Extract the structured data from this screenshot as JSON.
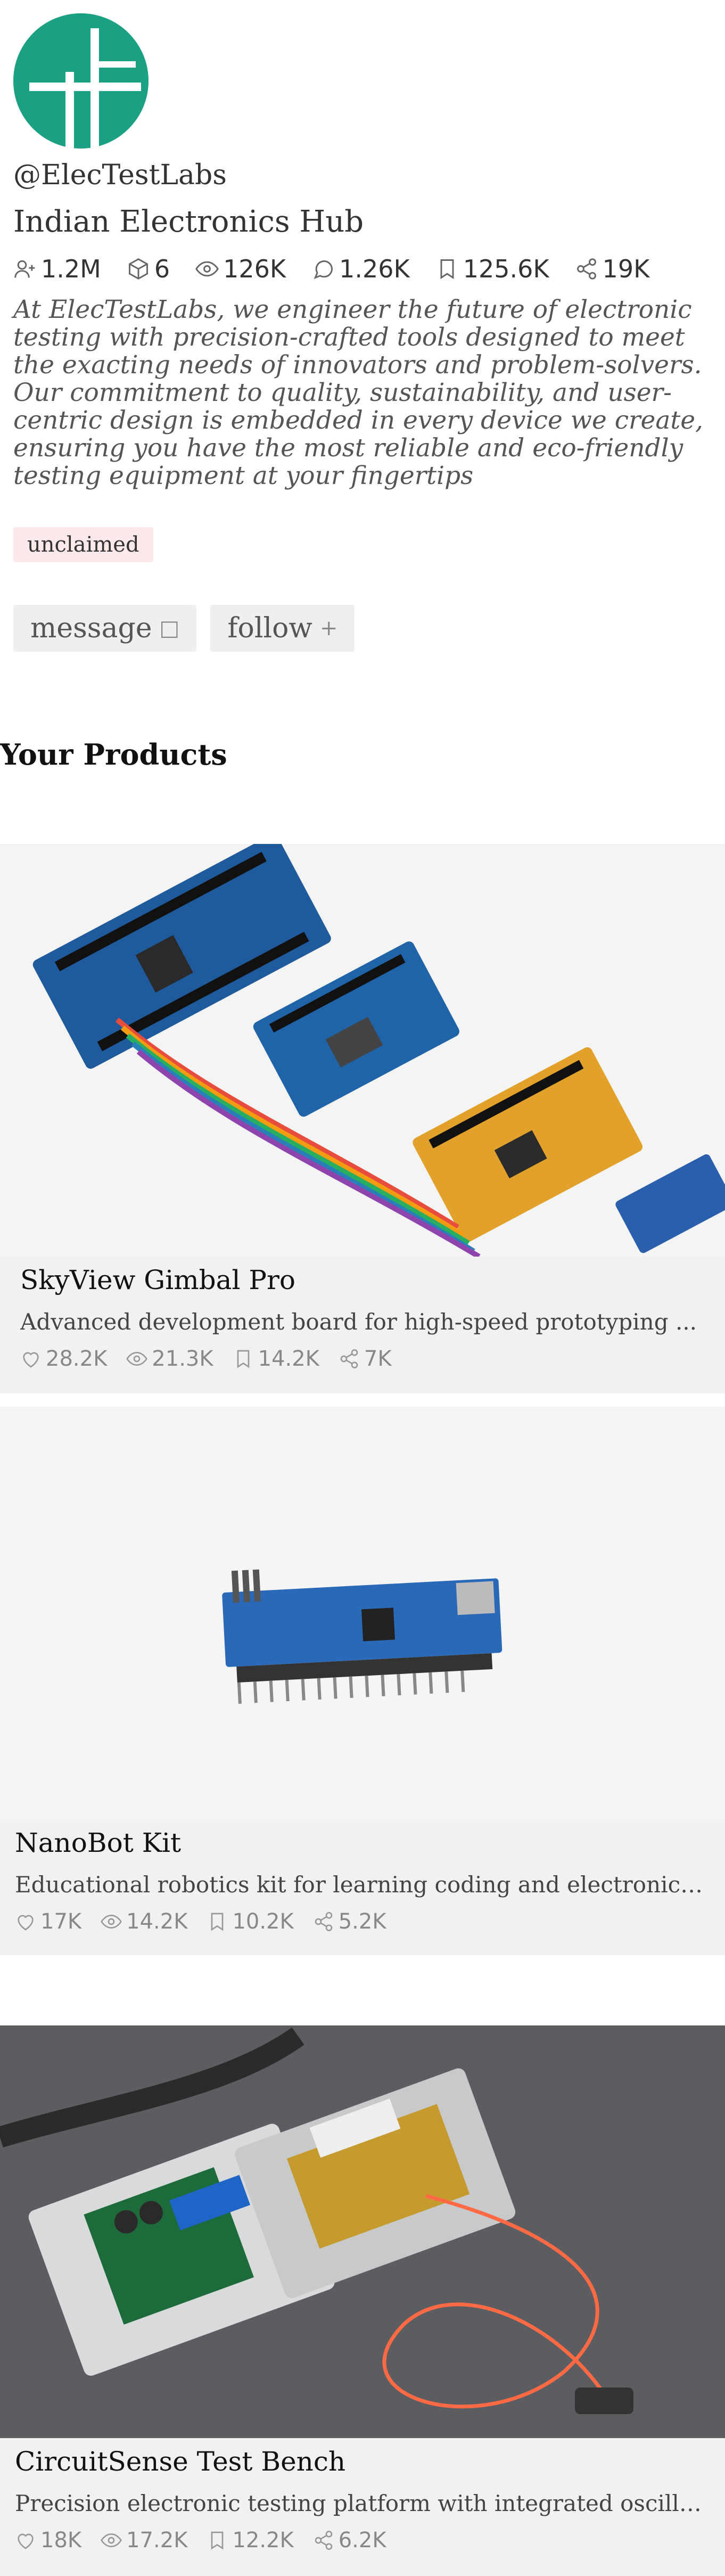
{
  "profile": {
    "handle": "@ElecTestLabs",
    "org": "Indian Electronics Hub",
    "stats": {
      "followers": "1.2M",
      "products": "6",
      "views": "126K",
      "comments": "1.26K",
      "saves": "125.6K",
      "shares": "19K"
    },
    "bio": "At ElecTestLabs, we engineer the future of electronic testing with precision-crafted tools designed to meet the exacting needs of innovators and problem-solvers. Our commitment to quality, sustainability, and user-centric design is embedded in every device we create, ensuring you have the most reliable and eco-friendly testing equipment at your fingertips",
    "badge": "unclaimed",
    "actions": {
      "message": "message",
      "follow": "follow"
    }
  },
  "section_title": "Your Products",
  "products": [
    {
      "name": "SkyView Gimbal Pro",
      "desc": "Advanced development board for high-speed prototyping ...",
      "likes": "28.2K",
      "views": "21.3K",
      "saves": "14.2K",
      "shares": "7K"
    },
    {
      "name": "NanoBot Kit",
      "desc": "Educational robotics kit for learning coding and electronics...",
      "likes": "17K",
      "views": "14.2K",
      "saves": "10.2K",
      "shares": "5.2K"
    },
    {
      "name": "CircuitSense Test Bench",
      "desc": "Precision electronic testing platform with integrated oscillos...",
      "likes": "18K",
      "views": "17.2K",
      "saves": "12.2K",
      "shares": "6.2K"
    }
  ],
  "colors": {
    "avatar": "#1aa184",
    "badge_bg": "#fde9e9",
    "card_bg": "#f1f1f1"
  },
  "icons": [
    "user-plus-icon",
    "cube-icon",
    "eye-icon",
    "comment-icon",
    "bookmark-icon",
    "share-icon",
    "heart-icon"
  ]
}
